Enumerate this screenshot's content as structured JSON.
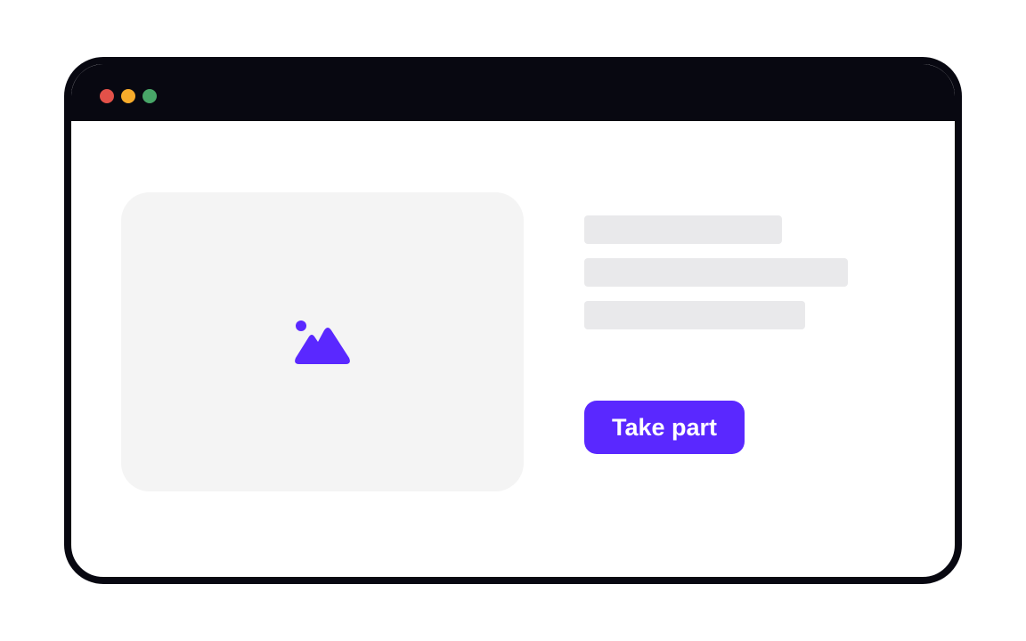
{
  "window": {
    "title_bar_color": "#080811",
    "controls": [
      {
        "name": "close",
        "color": "#e35149"
      },
      {
        "name": "minimize",
        "color": "#f7ab2b"
      },
      {
        "name": "maximize",
        "color": "#48a668"
      }
    ]
  },
  "main": {
    "image_placeholder": {
      "background": "#f4f4f4",
      "icon": "image-icon",
      "icon_color": "#5a28ff"
    },
    "text_placeholders": [
      {
        "color": "#e9e9eb"
      },
      {
        "color": "#e9e9eb"
      },
      {
        "color": "#e9e9eb"
      }
    ],
    "cta": {
      "label": "Take part",
      "color": "#5a28ff",
      "text_color": "#ffffff"
    }
  }
}
